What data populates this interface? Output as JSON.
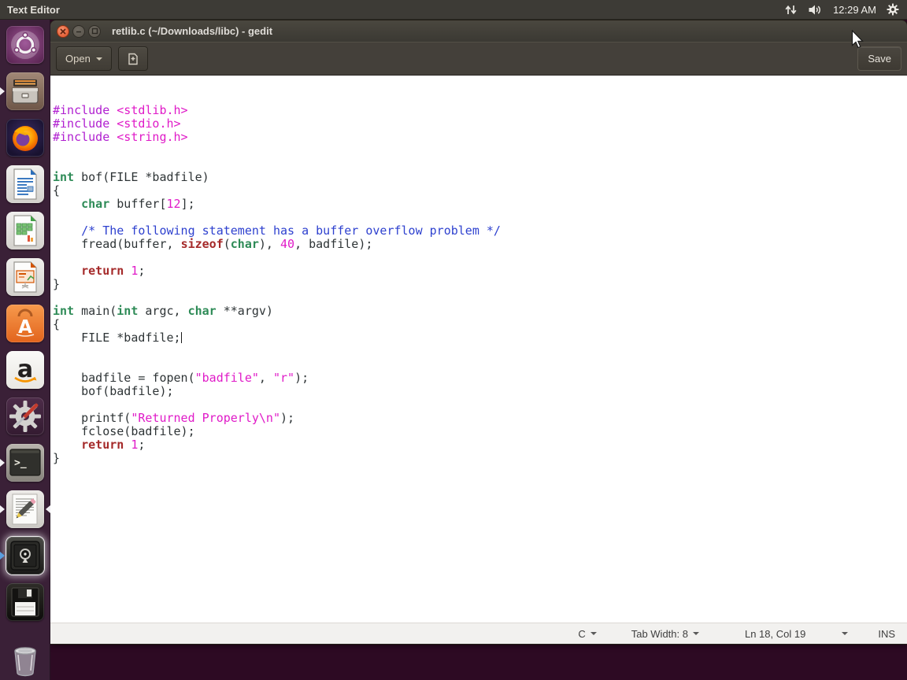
{
  "colors": {
    "desktop_bg": "#2d0a23",
    "panel_bg": "#3d3b36",
    "launcher_bg": "#3a2037",
    "titlebar_top": "#4a473f",
    "titlebar_bottom": "#3b3933",
    "toolbar_bg": "#44403a",
    "editor_bg": "#ffffff",
    "statusbar_bg": "#f2f1ef",
    "close_button": "#e8673f",
    "syn_plain": "#2e3436",
    "syn_preproc": "#b01fd0",
    "syn_string": "#e01bc8",
    "syn_number": "#e01bc8",
    "syn_type": "#2e8b57",
    "syn_keyword": "#a52a2a",
    "syn_comment": "#2e41cf"
  },
  "top_panel": {
    "app_name": "Text Editor",
    "clock": "12:29 AM",
    "icons": [
      "network-arrows-icon",
      "volume-icon",
      "session-gear-icon"
    ]
  },
  "launcher": {
    "items": [
      {
        "name": "ubuntu-dash",
        "running": false,
        "focused": false,
        "highlight": false
      },
      {
        "name": "files",
        "running": true,
        "focused": false,
        "highlight": false
      },
      {
        "name": "firefox",
        "running": false,
        "focused": false,
        "highlight": false
      },
      {
        "name": "libreoffice-writer",
        "running": false,
        "focused": false,
        "highlight": false
      },
      {
        "name": "libreoffice-calc",
        "running": false,
        "focused": false,
        "highlight": false
      },
      {
        "name": "libreoffice-impress",
        "running": false,
        "focused": false,
        "highlight": false
      },
      {
        "name": "ubuntu-software",
        "running": false,
        "focused": false,
        "highlight": false
      },
      {
        "name": "amazon",
        "running": false,
        "focused": false,
        "highlight": false
      },
      {
        "name": "system-settings",
        "running": false,
        "focused": false,
        "highlight": false
      },
      {
        "name": "terminal",
        "running": true,
        "focused": false,
        "highlight": false
      },
      {
        "name": "text-editor-gedit",
        "running": true,
        "focused": true,
        "highlight": false
      },
      {
        "name": "safe-vault",
        "running": true,
        "focused": false,
        "highlight": true,
        "pip": "blue"
      },
      {
        "name": "floppy-disk",
        "running": false,
        "focused": false,
        "highlight": false
      },
      {
        "name": "trash",
        "running": false,
        "focused": false,
        "highlight": false
      }
    ]
  },
  "window": {
    "title": "retlib.c (~/Downloads/libc) - gedit",
    "controls": [
      "close",
      "minimize",
      "maximize"
    ],
    "toolbar": {
      "open_label": "Open",
      "save_label": "Save"
    },
    "statusbar": {
      "language": "C",
      "tab_width": "Tab Width: 8",
      "position": "Ln 18, Col 19",
      "mode": "INS"
    }
  },
  "editor": {
    "cursor": {
      "line": 18,
      "col": 19
    },
    "lines": [
      [
        {
          "t": "#include ",
          "c": "pp"
        },
        {
          "t": "<stdlib.h>",
          "c": "str"
        }
      ],
      [
        {
          "t": "#include ",
          "c": "pp"
        },
        {
          "t": "<stdio.h>",
          "c": "str"
        }
      ],
      [
        {
          "t": "#include ",
          "c": "pp"
        },
        {
          "t": "<string.h>",
          "c": "str"
        }
      ],
      [],
      [],
      [
        {
          "t": "int",
          "c": "type"
        },
        {
          "t": " bof(FILE *badfile)",
          "c": ""
        }
      ],
      [
        {
          "t": "{",
          "c": ""
        }
      ],
      [
        {
          "t": "    ",
          "c": ""
        },
        {
          "t": "char",
          "c": "type"
        },
        {
          "t": " buffer[",
          "c": ""
        },
        {
          "t": "12",
          "c": "num"
        },
        {
          "t": "];",
          "c": ""
        }
      ],
      [],
      [
        {
          "t": "    ",
          "c": ""
        },
        {
          "t": "/* The following statement has a buffer overflow problem */",
          "c": "com"
        }
      ],
      [
        {
          "t": "    fread(buffer, ",
          "c": ""
        },
        {
          "t": "sizeof",
          "c": "kw"
        },
        {
          "t": "(",
          "c": ""
        },
        {
          "t": "char",
          "c": "type"
        },
        {
          "t": "), ",
          "c": ""
        },
        {
          "t": "40",
          "c": "num"
        },
        {
          "t": ", badfile);",
          "c": ""
        }
      ],
      [],
      [
        {
          "t": "    ",
          "c": ""
        },
        {
          "t": "return",
          "c": "kw"
        },
        {
          "t": " ",
          "c": ""
        },
        {
          "t": "1",
          "c": "num"
        },
        {
          "t": ";",
          "c": ""
        }
      ],
      [
        {
          "t": "}",
          "c": ""
        }
      ],
      [],
      [
        {
          "t": "int",
          "c": "type"
        },
        {
          "t": " main(",
          "c": ""
        },
        {
          "t": "int",
          "c": "type"
        },
        {
          "t": " argc, ",
          "c": ""
        },
        {
          "t": "char",
          "c": "type"
        },
        {
          "t": " **argv)",
          "c": ""
        }
      ],
      [
        {
          "t": "{",
          "c": ""
        }
      ],
      [
        {
          "t": "    FILE *badfile;",
          "c": ""
        },
        {
          "caret": true
        }
      ],
      [],
      [],
      [
        {
          "t": "    badfile = fopen(",
          "c": ""
        },
        {
          "t": "\"badfile\"",
          "c": "str"
        },
        {
          "t": ", ",
          "c": ""
        },
        {
          "t": "\"r\"",
          "c": "str"
        },
        {
          "t": ");",
          "c": ""
        }
      ],
      [
        {
          "t": "    bof(badfile);",
          "c": ""
        }
      ],
      [],
      [
        {
          "t": "    printf(",
          "c": ""
        },
        {
          "t": "\"Returned Properly\\n\"",
          "c": "str"
        },
        {
          "t": ");",
          "c": ""
        }
      ],
      [
        {
          "t": "    fclose(badfile);",
          "c": ""
        }
      ],
      [
        {
          "t": "    ",
          "c": ""
        },
        {
          "t": "return",
          "c": "kw"
        },
        {
          "t": " ",
          "c": ""
        },
        {
          "t": "1",
          "c": "num"
        },
        {
          "t": ";",
          "c": ""
        }
      ],
      [
        {
          "t": "}",
          "c": ""
        }
      ]
    ]
  }
}
